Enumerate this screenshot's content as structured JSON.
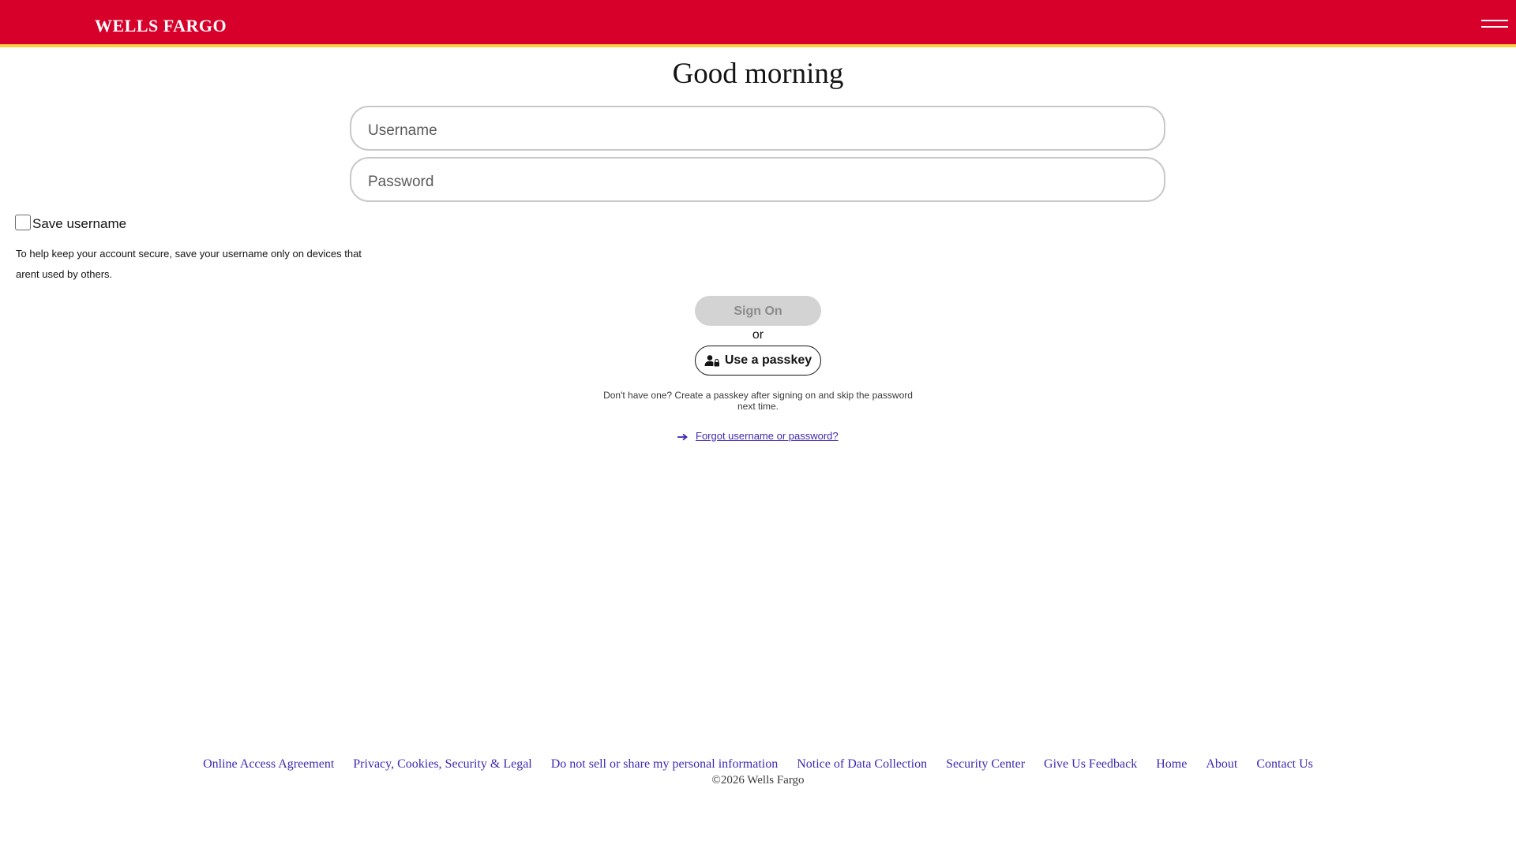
{
  "header": {
    "brand": "WELLS FARGO",
    "menu_icon": "hamburger-menu-icon",
    "background_color": "#d6002a",
    "accent_stripe_color": "#ffcd41"
  },
  "login": {
    "greeting": "Good morning",
    "username_placeholder": "Username",
    "password_placeholder": "Password",
    "save_username_label": "Save username",
    "save_username_checked": false,
    "save_help_text": "To help keep your account secure, save your username only on devices that arent used by others.",
    "sign_on_label": "Sign On",
    "or_text": "or",
    "passkey_label": "Use a passkey",
    "passkey_icon": "passkey-user-lock-icon",
    "passkey_note": "Don't have one? Create a passkey after signing on and skip the password next time.",
    "forgot_icon": "arrow-right-icon",
    "forgot_label": "Forgot username or password?"
  },
  "footer": {
    "links": [
      "Online Access Agreement",
      "Privacy, Cookies, Security & Legal",
      "Do not sell or share my personal information",
      "Notice of Data Collection",
      "Security Center",
      "Give Us Feedback",
      "Home",
      "About",
      "Contact Us"
    ],
    "copyright": "©2026 Wells Fargo",
    "link_color": "#3c2bb0"
  }
}
